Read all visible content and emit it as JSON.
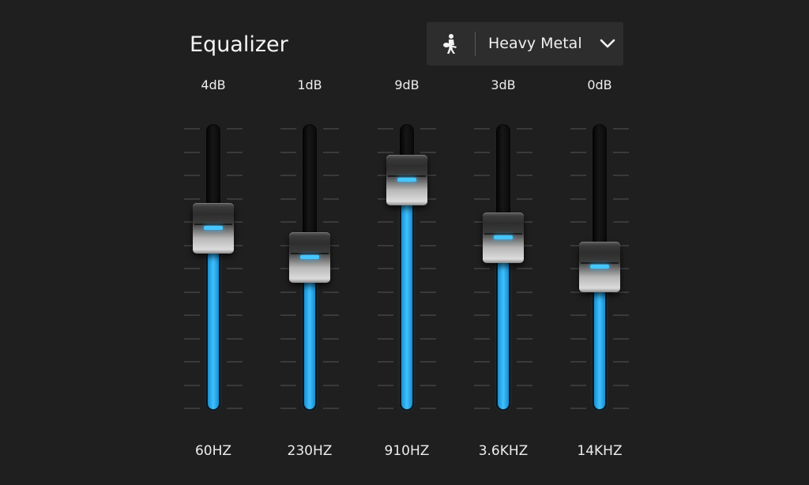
{
  "header": {
    "title": "Equalizer"
  },
  "preset": {
    "icon": "guitarist-icon",
    "label": "Heavy Metal",
    "dropdown_icon": "chevron-down-icon"
  },
  "colors": {
    "background": "#1f1f1f",
    "accent": "#3ec1ff",
    "text": "#f2f2f2"
  },
  "scale": {
    "min_db": -6,
    "max_db": 12
  },
  "bands": [
    {
      "frequency": "60HZ",
      "gain_label": "4dB",
      "gain": 4
    },
    {
      "frequency": "230HZ",
      "gain_label": "1dB",
      "gain": 1
    },
    {
      "frequency": "910HZ",
      "gain_label": "9dB",
      "gain": 9
    },
    {
      "frequency": "3.6KHZ",
      "gain_label": "3dB",
      "gain": 3
    },
    {
      "frequency": "14KHZ",
      "gain_label": "0dB",
      "gain": 0
    }
  ]
}
